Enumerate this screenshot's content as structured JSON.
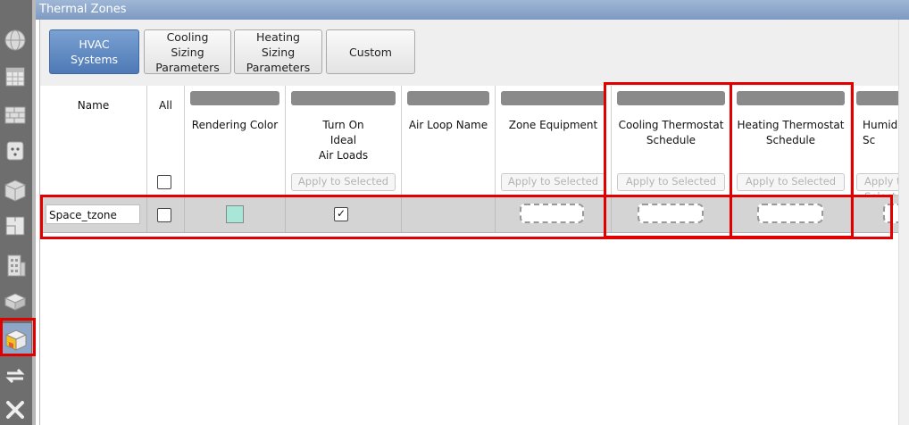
{
  "window": {
    "title": "Thermal Zones"
  },
  "sidebar": {
    "items": [
      {
        "icon": "globe-icon"
      },
      {
        "icon": "calendar-icon"
      },
      {
        "icon": "brick-wall-icon"
      },
      {
        "icon": "outlet-icon"
      },
      {
        "icon": "construction-cube-icon"
      },
      {
        "icon": "floorplan-icon"
      },
      {
        "icon": "building-icon"
      },
      {
        "icon": "space-type-icon"
      },
      {
        "icon": "thermal-zone-icon",
        "selected": true
      },
      {
        "icon": "loop-arrows-icon"
      },
      {
        "icon": "tools-icon"
      }
    ]
  },
  "tabs": [
    {
      "label": "HVAC\nSystems",
      "active": true
    },
    {
      "label": "Cooling\nSizing\nParameters"
    },
    {
      "label": "Heating\nSizing\nParameters"
    },
    {
      "label": "Custom"
    }
  ],
  "grid": {
    "apply_label": "Apply to Selected",
    "columns": {
      "name": "Name",
      "all": "All",
      "rendering_color": "Rendering Color",
      "ideal_air_loads": "Turn On\nIdeal\nAir Loads",
      "air_loop": "Air Loop Name",
      "zone_equipment": "Zone Equipment",
      "cooling_schedule": "Cooling Thermostat\nSchedule",
      "heating_schedule": "Heating Thermostat\nSchedule",
      "humidifying": "Humidif\nSc"
    },
    "rows": [
      {
        "name": "Space_tzone",
        "selected": false,
        "color": "#a8e6d7",
        "ideal_air_loads": true,
        "ideal_check_glyph": "✓"
      }
    ]
  },
  "colors": {
    "accent": "#4e79b5",
    "highlight": "#e00000"
  }
}
